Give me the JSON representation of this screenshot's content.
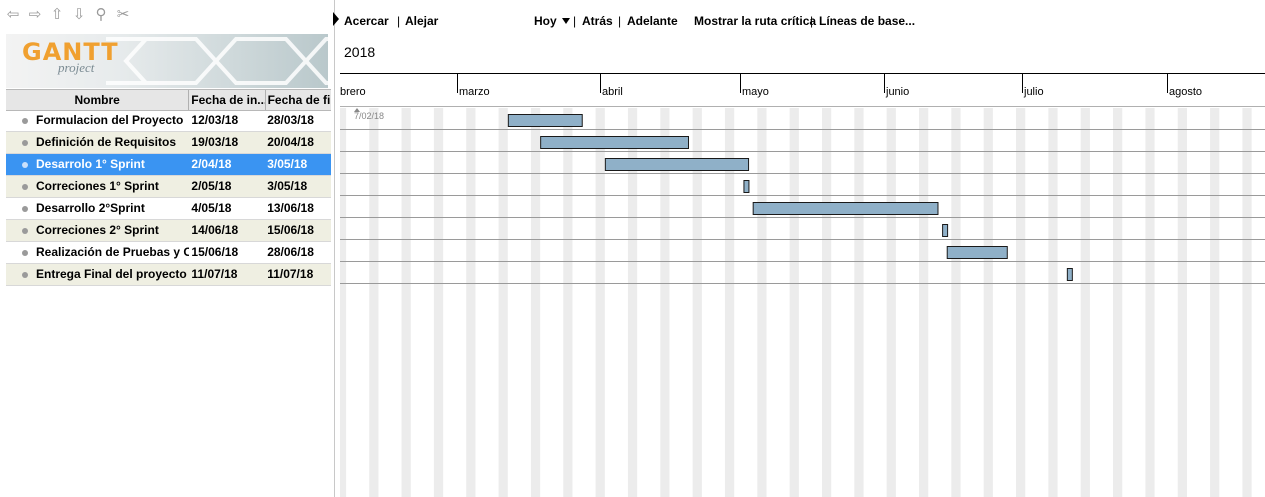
{
  "nav_icons": [
    "arrow-left-icon",
    "arrow-right-icon",
    "arrow-up-icon",
    "arrow-down-icon",
    "link-icon",
    "unlink-icon"
  ],
  "logo": {
    "name": "GANTT",
    "sub": "project"
  },
  "columns": {
    "name": "Nombre",
    "start": "Fecha de in...",
    "end": "Fecha de fin"
  },
  "tasks": [
    {
      "name": "Formulacion del Proyecto",
      "start": "12/03/18",
      "end": "28/03/18"
    },
    {
      "name": "Definición de Requisitos",
      "start": "19/03/18",
      "end": "20/04/18"
    },
    {
      "name": "Desarrolo 1° Sprint",
      "start": "2/04/18",
      "end": "3/05/18"
    },
    {
      "name": "Correciones 1° Sprint",
      "start": "2/05/18",
      "end": "3/05/18"
    },
    {
      "name": "Desarrollo 2°Sprint",
      "start": "4/05/18",
      "end": "13/06/18"
    },
    {
      "name": "Correciones 2° Sprint",
      "start": "14/06/18",
      "end": "15/06/18"
    },
    {
      "name": "Realización de Pruebas y C...",
      "start": "15/06/18",
      "end": "28/06/18"
    },
    {
      "name": "Entrega Final del proyecto",
      "start": "11/07/18",
      "end": "11/07/18"
    }
  ],
  "selected_task": 2,
  "toolbar": {
    "zoom_in": "Acercar",
    "sep1": "|",
    "zoom_out": "Alejar",
    "today": "Hoy",
    "sep2": "|",
    "back": "Atrás",
    "sep3": "|",
    "forward": "Adelante",
    "critical_path": "Mostrar la ruta crítica",
    "sep4": "|",
    "baselines": "Líneas de base..."
  },
  "year": "2018",
  "months": [
    "brero",
    "marzo",
    "abril",
    "mayo",
    "junio",
    "julio",
    "agosto"
  ],
  "today_marker": "7/02/18",
  "colors": {
    "bar": "#8fb0c8",
    "bar_border": "#1a1a1a",
    "selected_row": "#3a94f2",
    "alt_row": "#efefe2",
    "weekend": "#ececec"
  }
}
